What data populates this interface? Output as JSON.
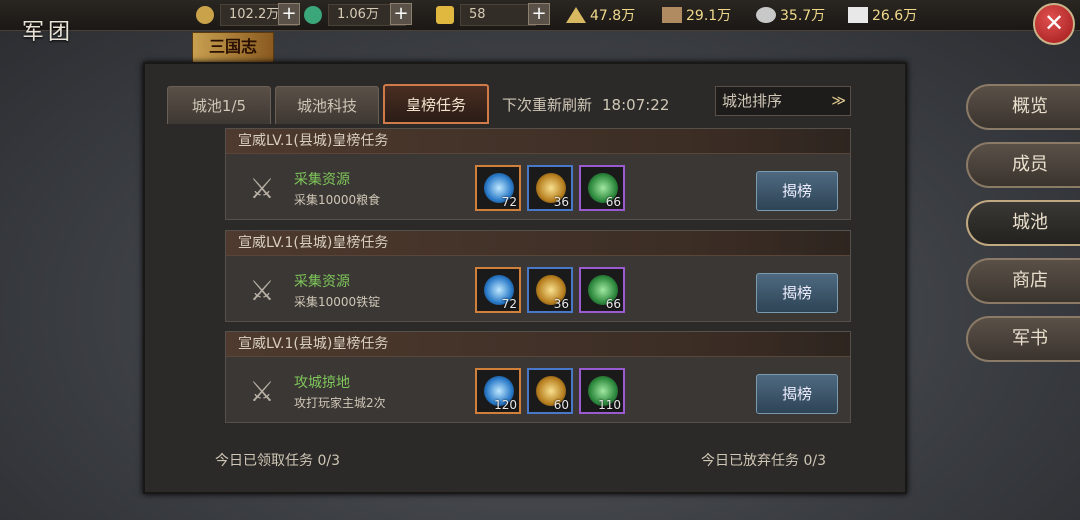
{
  "header": {
    "title": "军团",
    "logo_text": "三国志",
    "resources_left": [
      {
        "value": "102.2万",
        "color": "#c9a24a"
      },
      {
        "value": "1.06万",
        "color": "#3aa67a"
      },
      {
        "value": "58",
        "color": "#e0b840"
      }
    ],
    "resources_right": [
      {
        "value": "47.8万",
        "color": "#d8b860"
      },
      {
        "value": "29.1万",
        "color": "#b08a60"
      },
      {
        "value": "35.7万",
        "color": "#c8c8c8"
      },
      {
        "value": "26.6万",
        "color": "#e8e8e8"
      }
    ],
    "plus_label": "+",
    "close_label": "✕"
  },
  "tabs": [
    {
      "label": "城池1/5",
      "active": false
    },
    {
      "label": "城池科技",
      "active": false
    },
    {
      "label": "皇榜任务",
      "active": true
    }
  ],
  "refresh": {
    "label": "下次重新刷新",
    "time": "18:07:22"
  },
  "sort": {
    "label": "城池排序",
    "chevron": "≫"
  },
  "tasks": [
    {
      "title": "宣威LV.1(县城)皇榜任务",
      "name": "采集资源",
      "desc": "采集10000粮食",
      "rewards": [
        "72",
        "36",
        "66"
      ],
      "button": "揭榜"
    },
    {
      "title": "宣威LV.1(县城)皇榜任务",
      "name": "采集资源",
      "desc": "采集10000铁锭",
      "rewards": [
        "72",
        "36",
        "66"
      ],
      "button": "揭榜"
    },
    {
      "title": "宣威LV.1(县城)皇榜任务",
      "name": "攻城掠地",
      "desc": "攻打玩家主城2次",
      "rewards": [
        "120",
        "60",
        "110"
      ],
      "button": "揭榜"
    }
  ],
  "footer": {
    "accepted": "今日已领取任务 0/3",
    "abandoned": "今日已放弃任务 0/3"
  },
  "side_nav": [
    {
      "label": "概览",
      "active": false
    },
    {
      "label": "成员",
      "active": false
    },
    {
      "label": "城池",
      "active": true
    },
    {
      "label": "商店",
      "active": false
    },
    {
      "label": "军书",
      "active": false
    }
  ]
}
